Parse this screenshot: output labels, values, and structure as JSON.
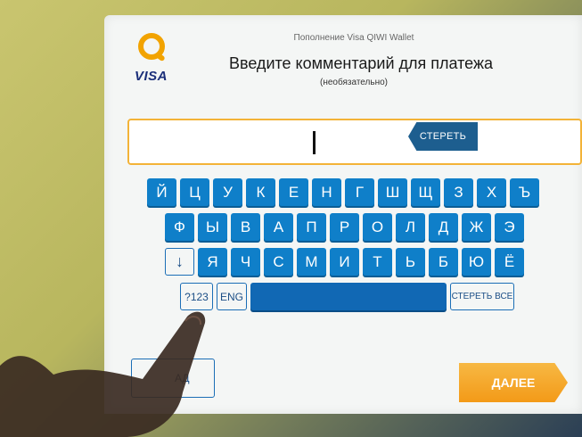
{
  "header": {
    "service": "Пополнение Visa QIWI Wallet",
    "title": "Введите комментарий для платежа",
    "subtitle": "(необязательно)",
    "brand": "VISA"
  },
  "input": {
    "value": "",
    "erase_label": "СТЕРЕТЬ"
  },
  "keyboard": {
    "row1": [
      "Й",
      "Ц",
      "У",
      "К",
      "Е",
      "Н",
      "Г",
      "Ш",
      "Щ",
      "З",
      "Х",
      "Ъ"
    ],
    "row2": [
      "Ф",
      "Ы",
      "В",
      "А",
      "П",
      "Р",
      "О",
      "Л",
      "Д",
      "Ж",
      "Э"
    ],
    "row3": [
      "Я",
      "Ч",
      "С",
      "М",
      "И",
      "Т",
      "Ь",
      "Б",
      "Ю",
      "Ё"
    ],
    "shift_icon": "arrow-down-icon",
    "shift_glyph": "↓",
    "numbers_label": "?123",
    "lang_label": "ENG",
    "clear_all_label": "СТЕРЕТЬ ВСЕ"
  },
  "footer": {
    "back_label": "АД",
    "next_label": "ДАЛЕЕ"
  },
  "colors": {
    "key": "#0f7fc9",
    "accent": "#f39a18",
    "input_border": "#f3b338"
  }
}
